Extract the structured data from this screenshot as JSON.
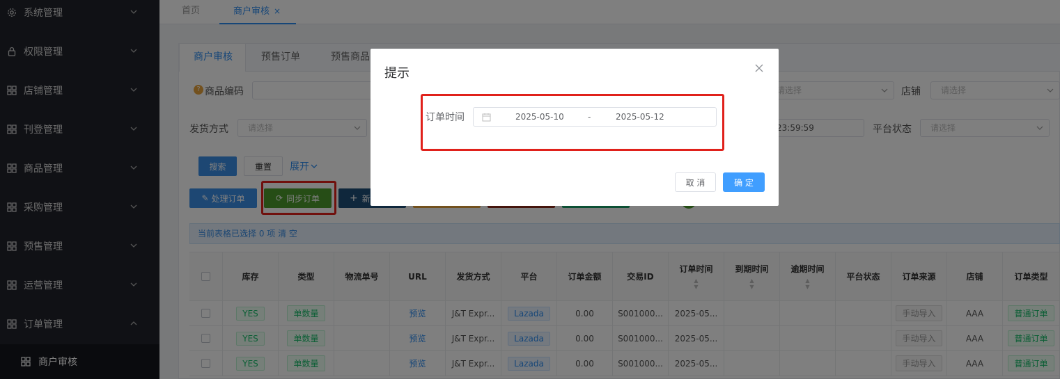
{
  "sidebar": {
    "items": [
      {
        "label": "系统管理",
        "icon": "gear-icon"
      },
      {
        "label": "权限管理",
        "icon": "lock-icon"
      },
      {
        "label": "店铺管理",
        "icon": "grid-icon"
      },
      {
        "label": "刊登管理",
        "icon": "grid-icon"
      },
      {
        "label": "商品管理",
        "icon": "grid-icon"
      },
      {
        "label": "采购管理",
        "icon": "grid-icon"
      },
      {
        "label": "预售管理",
        "icon": "grid-icon"
      },
      {
        "label": "运营管理",
        "icon": "grid-icon"
      },
      {
        "label": "订单管理",
        "icon": "grid-icon"
      }
    ],
    "sub_item": "商户审核"
  },
  "top_tabs": [
    {
      "label": "首页"
    },
    {
      "label": "商户审核",
      "close": "×"
    }
  ],
  "panel_tabs": [
    "商户审核",
    "预售订单",
    "预售商品"
  ],
  "filters": {
    "product_code_label": "商品编码",
    "shop_label": "店铺",
    "shop_placeholder": "请选择",
    "left_placeholder": "请选择",
    "ship_label": "发货方式",
    "ship_placeholder": "请选择",
    "time_end": "23:59:59",
    "platform_status_label": "平台状态",
    "platform_status_placeholder": "请选择"
  },
  "actions": {
    "search": "搜索",
    "reset": "重置",
    "expand": "展开",
    "process_order": "处理订单",
    "sync_order": "同步订单",
    "new_prefix": "新"
  },
  "selection_info": {
    "text": "当前表格已选择 0 项",
    "clear": "清 空"
  },
  "table": {
    "headers": [
      "库存",
      "类型",
      "物流单号",
      "URL",
      "发货方式",
      "平台",
      "订单金额",
      "交易ID",
      "订单时间",
      "到期时间",
      "逾期时间",
      "平台状态",
      "订单来源",
      "店铺",
      "订单类型"
    ],
    "rows": [
      {
        "stock": "YES",
        "type": "单数量",
        "tracking": "",
        "url": "预览",
        "ship": "J&T Expr...",
        "platform": "Lazada",
        "amount": "0.00",
        "trade_id": "S001000...",
        "order_time": "2025-05...",
        "source": "手动导入",
        "shop": "AAA",
        "order_type": "普通订单"
      },
      {
        "stock": "YES",
        "type": "单数量",
        "tracking": "",
        "url": "预览",
        "ship": "J&T Expr...",
        "platform": "Lazada",
        "amount": "0.00",
        "trade_id": "S001000...",
        "order_time": "2025-05...",
        "source": "手动导入",
        "shop": "AAA",
        "order_type": "普通订单"
      },
      {
        "stock": "YES",
        "type": "单数量",
        "tracking": "",
        "url": "预览",
        "ship": "J&T Expr...",
        "platform": "Lazada",
        "amount": "0.00",
        "trade_id": "S001000...",
        "order_time": "2025-05...",
        "source": "手动导入",
        "shop": "AAA",
        "order_type": "普通订单"
      }
    ]
  },
  "dialog": {
    "title": "提示",
    "field_label": "订单时间",
    "start_date": "2025-05-10",
    "separator": "-",
    "end_date": "2025-05-12",
    "cancel": "取 消",
    "confirm": "确 定"
  },
  "colors": {
    "accent": "#2d8cf0",
    "highlight": "#e0211b",
    "sidebar": "#20222a"
  }
}
